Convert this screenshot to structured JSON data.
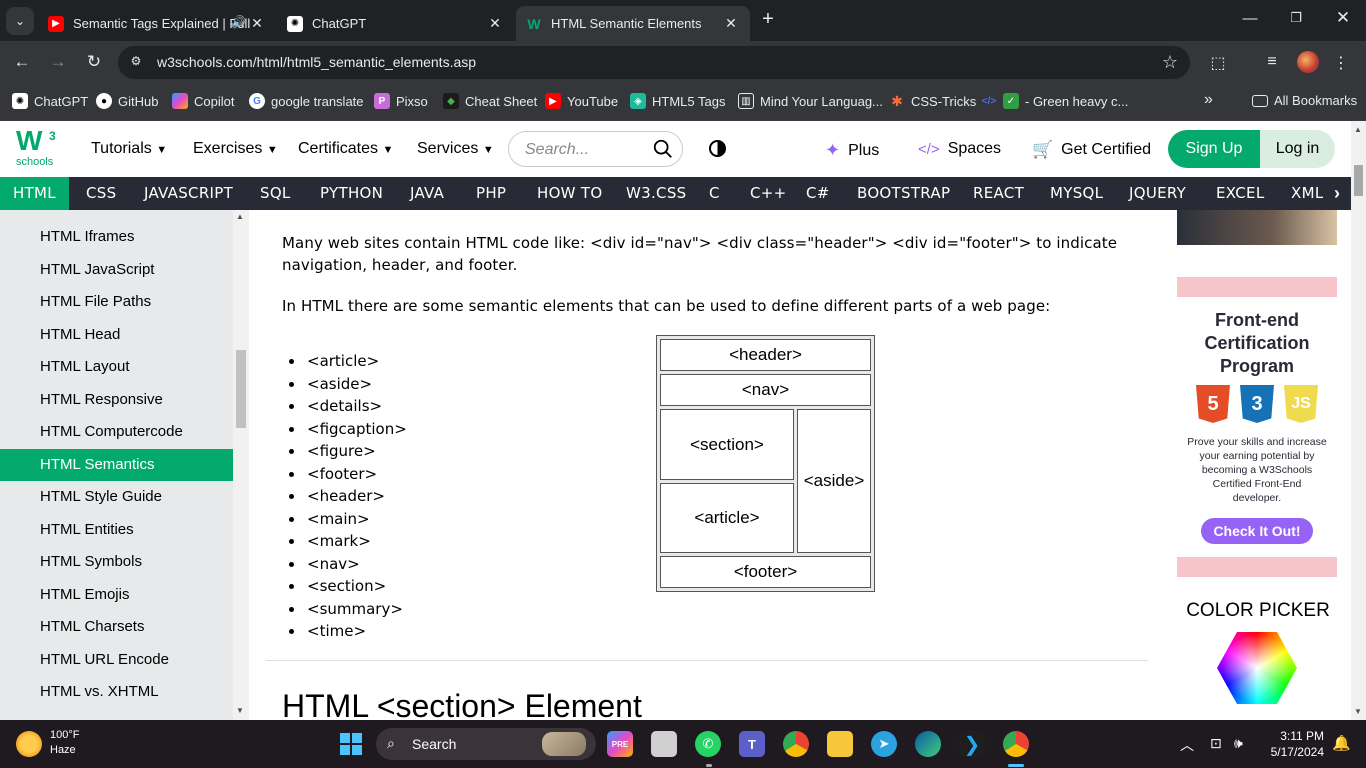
{
  "browser": {
    "tabs": [
      {
        "title": "Semantic Tags Explained | Full",
        "favicon": "youtube-icon"
      },
      {
        "title": "ChatGPT",
        "favicon": "chatgpt-icon"
      },
      {
        "title": "HTML Semantic Elements",
        "favicon": "w3schools-icon"
      }
    ],
    "url": "w3schools.com/html/html5_semantic_elements.asp",
    "bookmarks": [
      {
        "label": "ChatGPT",
        "icon": "chatgpt-icon"
      },
      {
        "label": "GitHub",
        "icon": "github-icon"
      },
      {
        "label": "Copilot",
        "icon": "copilot-icon"
      },
      {
        "label": "google translate",
        "icon": "google-icon"
      },
      {
        "label": "Pixso",
        "icon": "pixso-icon"
      },
      {
        "label": "Cheat Sheet",
        "icon": "cheat-sheet-icon"
      },
      {
        "label": "YouTube",
        "icon": "youtube-icon"
      },
      {
        "label": "HTML5 Tags",
        "icon": "html5-tags-icon"
      },
      {
        "label": "Mind Your Languag...",
        "icon": "building-icon"
      },
      {
        "label": "CSS-Tricks",
        "icon": "css-tricks-icon"
      },
      {
        "label": "- Green heavy c...",
        "icon": "checkbox-icon"
      }
    ],
    "all_bookmarks": "All Bookmarks"
  },
  "w3": {
    "logo_main": "W",
    "logo_sup": "3",
    "logo_sub": "schools",
    "nav": [
      "Tutorials",
      "Exercises",
      "Certificates",
      "Services"
    ],
    "search_placeholder": "Search...",
    "plus": "Plus",
    "spaces": "Spaces",
    "get_certified": "Get Certified",
    "sign_up": "Sign Up",
    "log_in": "Log in",
    "subnav": [
      "HTML",
      "CSS",
      "JAVASCRIPT",
      "SQL",
      "PYTHON",
      "JAVA",
      "PHP",
      "HOW TO",
      "W3.CSS",
      "C",
      "C++",
      "C#",
      "BOOTSTRAP",
      "REACT",
      "MYSQL",
      "JQUERY",
      "EXCEL",
      "XML"
    ]
  },
  "sidebar": {
    "items": [
      "HTML Iframes",
      "HTML JavaScript",
      "HTML File Paths",
      "HTML Head",
      "HTML Layout",
      "HTML Responsive",
      "HTML Computercode",
      "HTML Semantics",
      "HTML Style Guide",
      "HTML Entities",
      "HTML Symbols",
      "HTML Emojis",
      "HTML Charsets",
      "HTML URL Encode",
      "HTML vs. XHTML"
    ],
    "active": "HTML Semantics"
  },
  "content": {
    "para1_line1": "Many web sites contain HTML code like: <div id=\"nav\"> <div class=\"header\"> <div id=\"footer\"> to indicate",
    "para1_line2": "navigation, header, and footer.",
    "para2": "In HTML there are some semantic elements that can be used to define different parts of a web page:",
    "elements": [
      "<article>",
      "<aside>",
      "<details>",
      "<figcaption>",
      "<figure>",
      "<footer>",
      "<header>",
      "<main>",
      "<mark>",
      "<nav>",
      "<section>",
      "<summary>",
      "<time>"
    ],
    "diagram": {
      "header": "<header>",
      "nav": "<nav>",
      "section": "<section>",
      "article": "<article>",
      "aside": "<aside>",
      "footer": "<footer>"
    },
    "heading": "HTML <section> Element"
  },
  "ads": {
    "title": "Front-end Certification Program",
    "badges": [
      "5",
      "3",
      "JS"
    ],
    "desc": "Prove your skills and increase your earning potential by becoming a W3Schools Certified Front-End developer.",
    "cta": "Check It Out!",
    "color_picker": "COLOR PICKER"
  },
  "taskbar": {
    "temperature": "100°F",
    "weather": "Haze",
    "search": "Search",
    "time": "3:11 PM",
    "date": "5/17/2024",
    "apps": [
      "copilot-pre-icon",
      "file-manager-icon",
      "whatsapp-icon",
      "teams-icon",
      "chrome-icon",
      "file-explorer-icon",
      "telegram-icon",
      "edge-icon",
      "vscode-icon",
      "chrome-canary-icon"
    ]
  },
  "colors": {
    "w3_green": "#04AA6D",
    "subnav_bg": "#282A35",
    "sidebar_bg": "#E7E9EB",
    "cta_purple": "#9763f6"
  }
}
